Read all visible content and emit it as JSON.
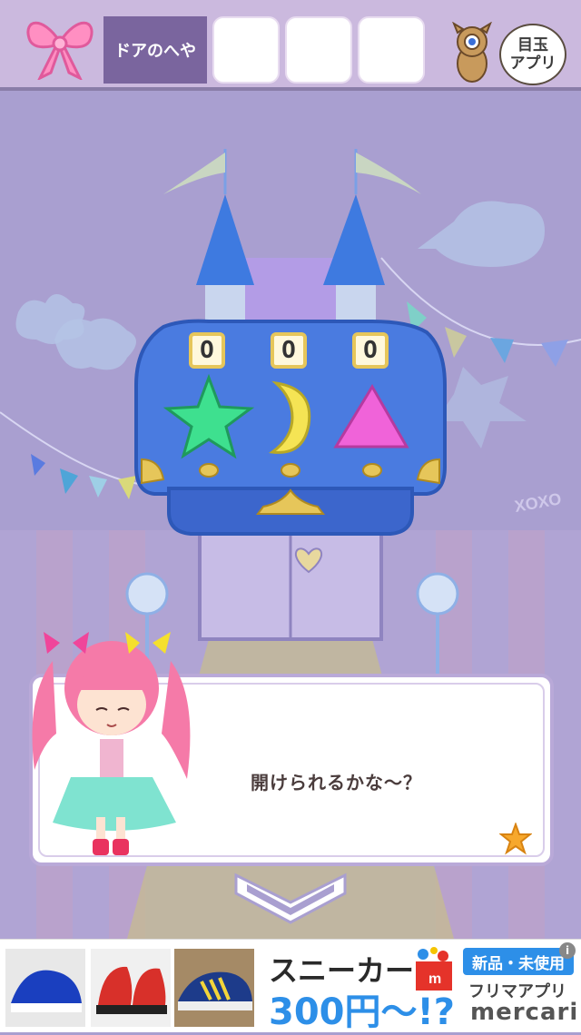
{
  "header": {
    "current_room": "ドアのへや",
    "inventory_slots": 3,
    "app_bubble": {
      "line1": "目玉",
      "line2": "アプリ"
    }
  },
  "chest": {
    "locks": [
      {
        "letter": "O",
        "shape": "star",
        "color": "#3ee08f"
      },
      {
        "letter": "O",
        "shape": "moon",
        "color": "#f5e454"
      },
      {
        "letter": "O",
        "shape": "triangle",
        "color": "#f063d9"
      }
    ]
  },
  "scene_text": {
    "xoxo": "XOXO"
  },
  "dialog": {
    "message": "開けられるかな～？"
  },
  "ad": {
    "headline": "スニーカー",
    "price": "300円～!?",
    "tag": "新品・未使用",
    "subtitle": "フリマアプリ",
    "brand": "mercari",
    "info": "i"
  },
  "colors": {
    "topbar": "#cbb9de",
    "active_room": "#7a659e",
    "chest_blue": "#4a7be0",
    "ad_blue": "#2d8fe8"
  }
}
